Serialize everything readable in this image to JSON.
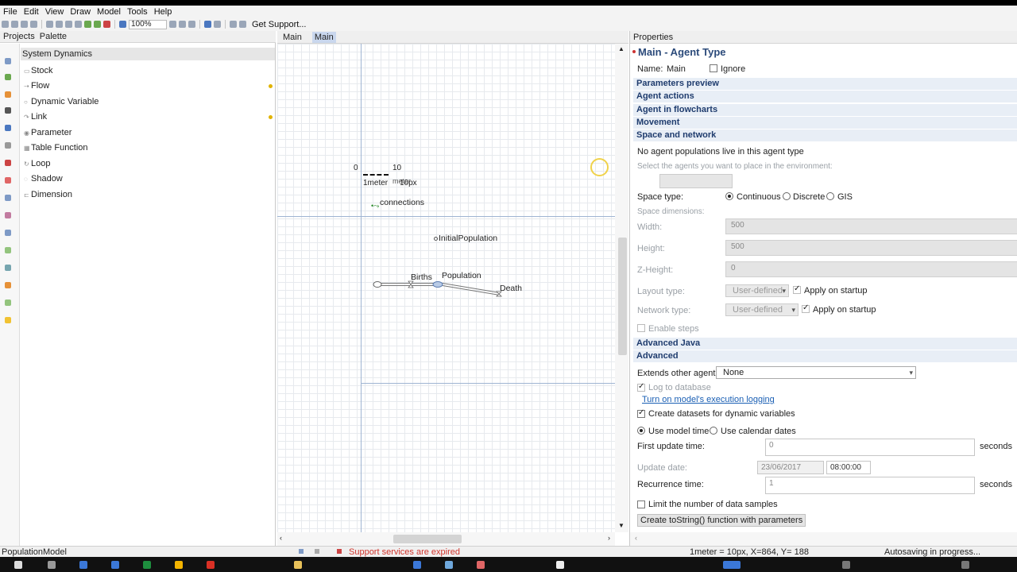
{
  "menu": [
    "File",
    "Edit",
    "View",
    "Draw",
    "Model",
    "Tools",
    "Help"
  ],
  "toolbar": {
    "zoom": "100%",
    "support_label": "Get Support..."
  },
  "left_panel": {
    "tabs": [
      "Projects",
      "Palette"
    ],
    "palette_header": "System Dynamics",
    "items": [
      "Stock",
      "Flow",
      "Dynamic Variable",
      "Link",
      "Parameter",
      "Table Function",
      "Loop",
      "Shadow",
      "Dimension"
    ]
  },
  "editor": {
    "tabs": [
      "Main",
      "Main"
    ],
    "scale": {
      "zero": "0",
      "ten": "10",
      "meter_label": "1meter",
      "px_label": "10px",
      "overlap_label": "meter"
    },
    "elements": {
      "connections": "connections",
      "initial_population": "InitialPopulation",
      "births": "Births",
      "population": "Population",
      "death": "Death"
    }
  },
  "properties": {
    "tab": "Properties",
    "title": "Main - Agent Type",
    "name_label": "Name:",
    "name_value": "Main",
    "ignore_label": "Ignore",
    "sections": {
      "parameters_preview": "Parameters preview",
      "agent_actions": "Agent actions",
      "agent_in_flowcharts": "Agent in flowcharts",
      "movement": "Movement",
      "space_and_network": "Space and network",
      "advanced_java": "Advanced Java",
      "advanced": "Advanced"
    },
    "space": {
      "no_populations": "No agent populations live in this agent type",
      "select_agents": "Select the agents you want to place in the environment:",
      "space_type_label": "Space type:",
      "space_types": [
        "Continuous",
        "Discrete",
        "GIS"
      ],
      "space_dimensions": "Space dimensions:",
      "width_label": "Width:",
      "width_value": "500",
      "height_label": "Height:",
      "height_value": "500",
      "zheight_label": "Z-Height:",
      "zheight_value": "0",
      "layout_type_label": "Layout type:",
      "layout_type_value": "User-defined",
      "network_type_label": "Network type:",
      "network_type_value": "User-defined",
      "apply_on_startup": "Apply on startup",
      "enable_steps": "Enable steps"
    },
    "advanced": {
      "extends_label": "Extends other agent:",
      "extends_value": "None",
      "log_to_db": "Log to database",
      "turn_on_logging": "Turn on model's execution logging",
      "create_datasets": "Create datasets for dynamic variables",
      "time_modes": [
        "Use model time",
        "Use calendar dates"
      ],
      "first_update_label": "First update time:",
      "first_update_value": "0",
      "seconds": "seconds",
      "update_date_label": "Update date:",
      "update_date_value": "23/06/2017",
      "update_time_value": "08:00:00",
      "recurrence_label": "Recurrence time:",
      "recurrence_value": "1",
      "limit_samples": "Limit the number of data samples",
      "tostring_button": "Create toString() function with parameters"
    }
  },
  "status": {
    "project": "PopulationModel",
    "support": "Support services are expired",
    "coords": "1meter = 10px, X=864, Y= 188",
    "autosave": "Autosaving in progress..."
  }
}
